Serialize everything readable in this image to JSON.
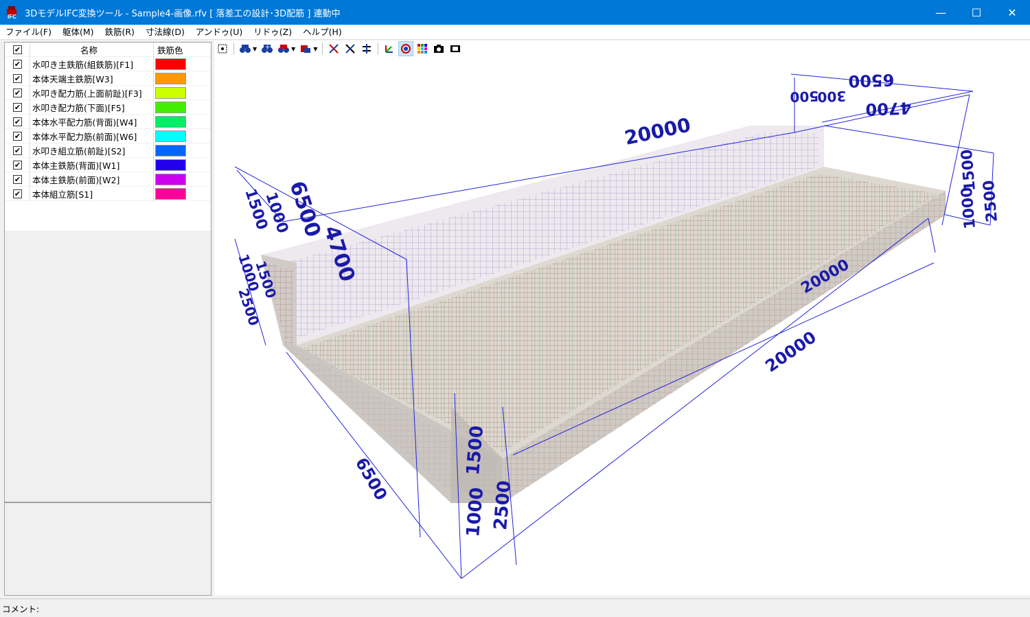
{
  "window": {
    "title": "3DモデルIFC変換ツール - Sample4-画像.rfv [ 落差工の設計･3D配筋 ] 連動中",
    "minimize": "—",
    "maximize": "☐",
    "close": "✕"
  },
  "menu": [
    "ファイル(F)",
    "躯体(M)",
    "鉄筋(R)",
    "寸法線(D)",
    "アンドゥ(U)",
    "リドゥ(Z)",
    "ヘルプ(H)"
  ],
  "list": {
    "header_name": "名称",
    "header_color": "鉄筋色",
    "rows": [
      {
        "name": "水叩き主鉄筋(組鉄筋)[F1]",
        "color": "#ff0000",
        "checked": true
      },
      {
        "name": "本体天端主鉄筋[W3]",
        "color": "#ff9900",
        "checked": true
      },
      {
        "name": "水叩き配力筋(上面前趾)[F3]",
        "color": "#ccff00",
        "checked": true
      },
      {
        "name": "水叩き配力筋(下面)[F5]",
        "color": "#44ee00",
        "checked": true
      },
      {
        "name": "本体水平配力筋(背面)[W4]",
        "color": "#00ee66",
        "checked": true
      },
      {
        "name": "本体水平配力筋(前面)[W6]",
        "color": "#00ffff",
        "checked": true
      },
      {
        "name": "水叩き組立筋(前趾)[S2]",
        "color": "#0066ff",
        "checked": true
      },
      {
        "name": "本体主鉄筋(背面)[W1]",
        "color": "#2200ee",
        "checked": true
      },
      {
        "name": "本体主鉄筋(前面)[W2]",
        "color": "#cc00ee",
        "checked": true
      },
      {
        "name": "本体組立筋[S1]",
        "color": "#ff0099",
        "checked": true
      }
    ]
  },
  "toolbar": {
    "icons": [
      "select-all-icon",
      "find-icon",
      "find-add-icon",
      "find-remove-icon",
      "layer-icon",
      "rebar-select-icon",
      "cross-icon",
      "align-icon",
      "axis-icon",
      "target-icon",
      "palette-icon",
      "camera-icon",
      "film-icon"
    ]
  },
  "dimensions": {
    "top_length": "20000",
    "right_total": "6500",
    "right_inner": "4700",
    "right_small": "300",
    "right_small2": "500",
    "right_height_a": "1000",
    "right_height_b": "1500",
    "right_height_c": "2500",
    "left_width": "6500",
    "left_inner": "4700",
    "left_height": "1500",
    "left_height2": "1000",
    "left_side": "1000",
    "left_side2": "1500",
    "left_side3": "2500",
    "bottom_length": "20000",
    "floor_length": "20000",
    "front_height_a": "1000",
    "front_height_b": "1500",
    "front_height_c": "2500",
    "bottom_width": "6500"
  },
  "status": {
    "comment_label": "コメント:"
  }
}
